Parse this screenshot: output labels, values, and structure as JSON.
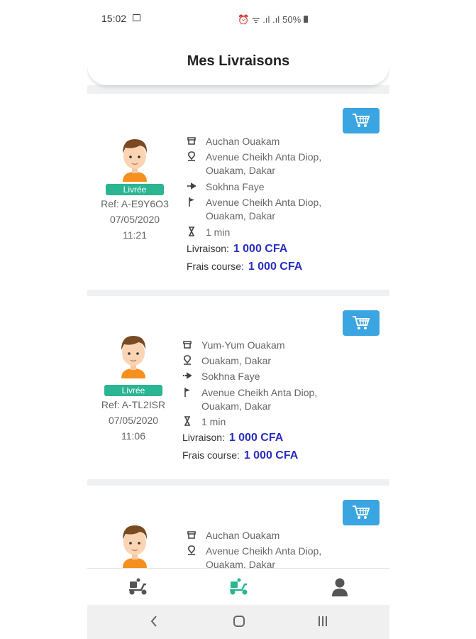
{
  "status_bar": {
    "time": "15:02",
    "indicators": "⏰ ᯤ .ıl .ıl",
    "battery": "50%"
  },
  "header": {
    "title": "Mes Livraisons"
  },
  "deliveries": [
    {
      "status": "Livrée",
      "ref": "Ref: A-E9Y6O3",
      "date": "07/05/2020",
      "time": "11:21",
      "store": "Auchan Ouakam",
      "pickup_line1": "Avenue Cheikh Anta Diop,",
      "pickup_line2": "Ouakam, Dakar",
      "customer": "Sokhna Faye",
      "dest_line1": "Avenue Cheikh Anta Diop,",
      "dest_line2": "Ouakam, Dakar",
      "duration": "1 min",
      "delivery_label": "Livraison:",
      "delivery_price": "1 000 CFA",
      "fee_label": "Frais course:",
      "fee_price": "1 000 CFA"
    },
    {
      "status": "Livrée",
      "ref": "Ref: A-TL2ISR",
      "date": "07/05/2020",
      "time": "11:06",
      "store": "Yum-Yum Ouakam",
      "pickup_line1": "Ouakam, Dakar",
      "customer": "Sokhna Faye",
      "dest_line1": "Avenue Cheikh Anta Diop,",
      "dest_line2": "Ouakam, Dakar",
      "duration": "1 min",
      "delivery_label": "Livraison:",
      "delivery_price": "1 000 CFA",
      "fee_label": "Frais course:",
      "fee_price": "1 000 CFA"
    },
    {
      "store": "Auchan Ouakam",
      "pickup_line1": "Avenue Cheikh Anta Diop,",
      "pickup_line2": "Ouakam, Dakar"
    }
  ],
  "bottom_nav": [
    {
      "icon": "scooter-icon",
      "active": false
    },
    {
      "icon": "scooter-icon",
      "active": true
    },
    {
      "icon": "user-icon",
      "active": false
    }
  ],
  "colors": {
    "accent_blue": "#3aa5e0",
    "badge_green": "#2bb592",
    "price_blue": "#2a2fbf",
    "active_nav": "#2bb592"
  }
}
